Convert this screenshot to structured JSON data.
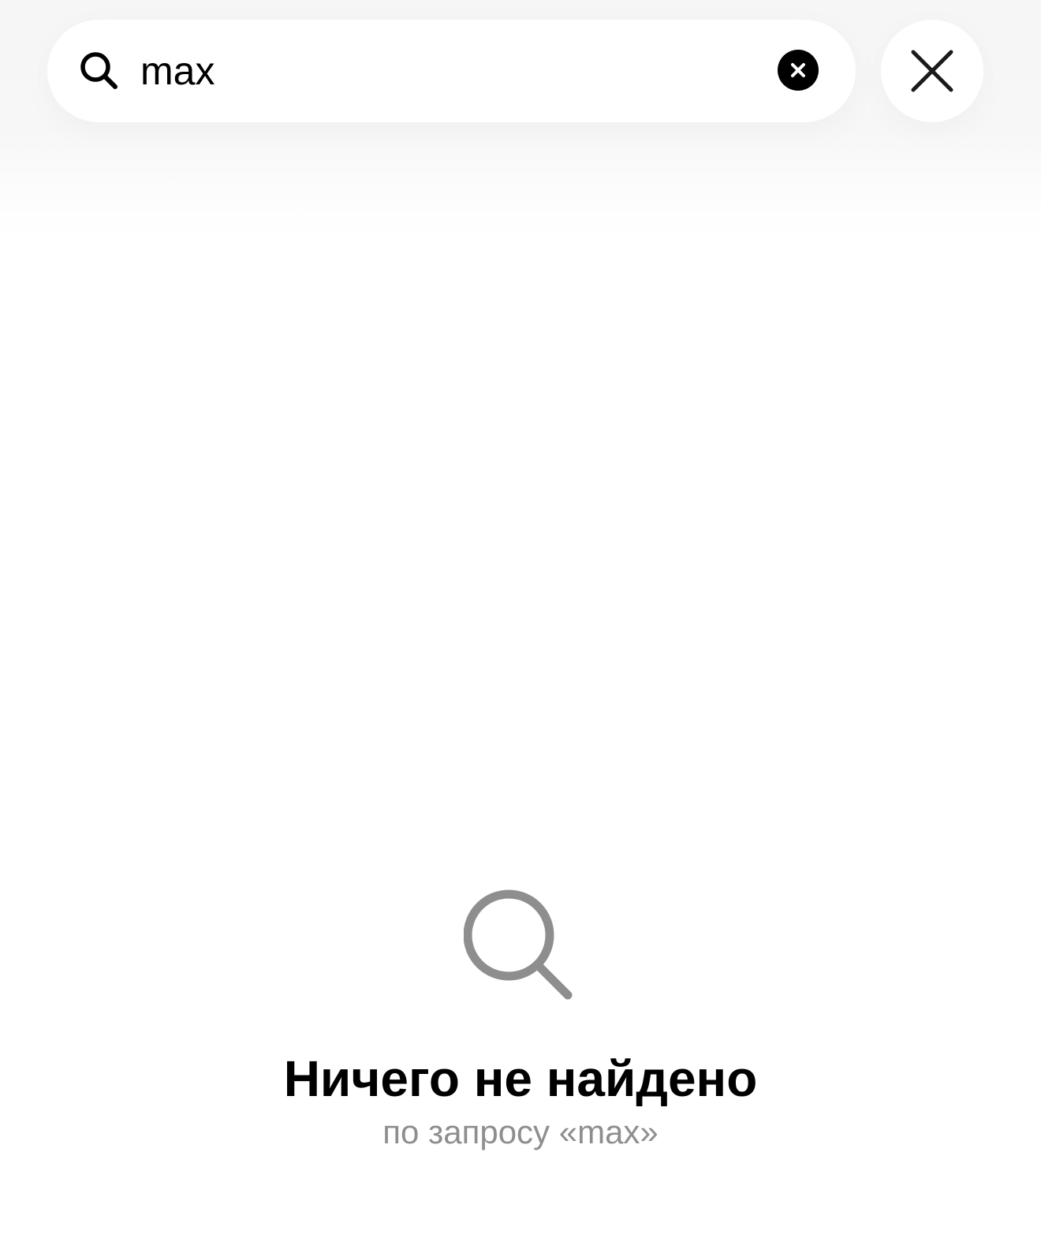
{
  "search": {
    "value": "max",
    "icons": {
      "search": "search-icon",
      "clear": "clear-circle-x-icon",
      "close": "close-x-icon"
    }
  },
  "empty_state": {
    "icon": "search-icon",
    "title": "Ничего не найдено",
    "subtitle": "по запросу «max»"
  },
  "colors": {
    "background": "#ffffff",
    "top_area": "#f6f6f6",
    "text_primary": "#000000",
    "text_secondary": "#8e8e8e",
    "icon_muted": "#8e8e8e"
  }
}
